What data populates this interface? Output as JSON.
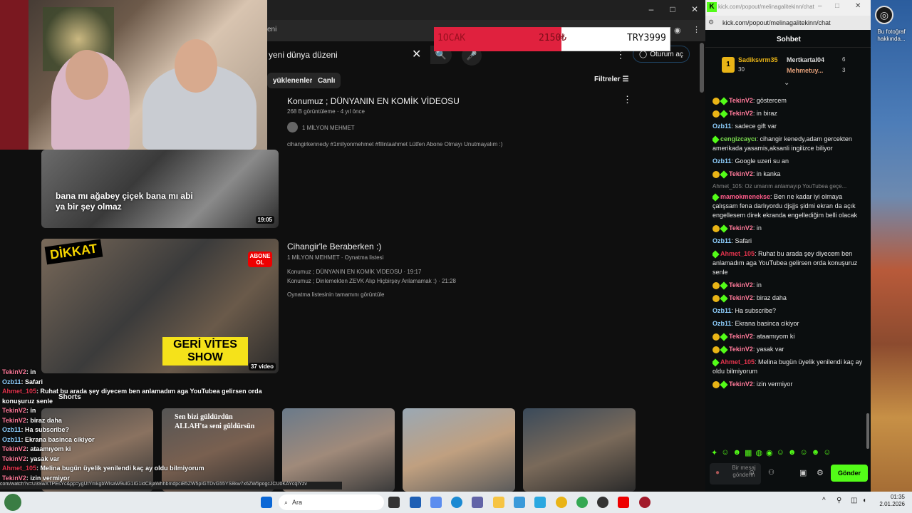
{
  "webcam": {
    "description_icon": "webcam-feed"
  },
  "youtube": {
    "url_fragment": "eni",
    "search_query": "yeni dünya düzeni",
    "signin_label": "Oturum aç",
    "chips": [
      "yüklenenler",
      "Canlı"
    ],
    "filters_label": "Filtreler",
    "videos": [
      {
        "title": "Konumuz ; DÜNYANIN EN KOMİK VİDEOSU",
        "meta": "268 B görüntüleme · 4 yıl önce",
        "channel": "1 MİLYON MEHMET",
        "description": "cihangirkennedy #1milyonmehmet #filintaahmet Lütfen Abone Olmayı Unutmayalım :)",
        "caption": "bana mı ağabey çiçek bana mı abi ya bir şey olmaz",
        "duration": "19:05"
      },
      {
        "title": "Cihangir'le Beraberken :)",
        "channel": "1 MİLYON MEHMET",
        "channel_suffix": "· Oynatma listesi",
        "line1": "Konumuz ; DÜNYANIN EN KOMİK VİDEOSU · 19:17",
        "line2": "Konumuz ; Dinlemekten ZEVK Alıp Hiçbirşey Anlamamak :) · 21:28",
        "line3": "Oynatma listesinin tamamını görüntüle",
        "thumb_text_top": "DİKKAT",
        "thumb_text_bottom": "GERİ VİTES SHOW",
        "thumb_badge": "ABONE OL",
        "count": "37 video"
      }
    ],
    "shorts_label": "Shorts",
    "short_caption": "Sen bizi güldürdün ALLAH'ta seni güldürsün",
    "status_url": "com/watch?v=U3SwXTPEsYc&pp=ygUtYmkgbWlsaW9uIG1lG1ldC8jaWhhbmdpciB5ZW5pIGTDvG55YS8kw7x6ZW5pogcJCU0KAYcqIYzv"
  },
  "overlay": {
    "month": "1OCAK",
    "current": "2150₺",
    "target": "TRY3999",
    "progress": 0.54
  },
  "chat": {
    "url": "kick.com/popout/melinagalitekinn/chat",
    "url_short": "kick.com/popout/melinagalitekinn/chat",
    "header": "Sohbet",
    "top_gifters": [
      {
        "name": "Sadiksvrm35",
        "count": "30"
      },
      {
        "name": "Mertkartal04",
        "count": "6"
      },
      {
        "name": "Mehmetuy...",
        "count": "3"
      }
    ],
    "messages": [
      {
        "user": "TekinV2",
        "text": ": göstercem",
        "cls": "u-yellow",
        "badges": "yg"
      },
      {
        "user": "TekinV2",
        "text": ": in biraz",
        "cls": "u-yellow",
        "badges": "yg"
      },
      {
        "user": "Ozb11",
        "text": ": sadece gift var",
        "cls": "u-blue",
        "badges": ""
      },
      {
        "user": "cengizcaycı",
        "text": ": cihangir kenedy,adam gercekten amerikada yasamis,aksanli ingilizce biliyor",
        "cls": "u-green",
        "badges": "g"
      },
      {
        "user": "Ozb11",
        "text": ": Google uzeri su an",
        "cls": "u-blue",
        "badges": ""
      },
      {
        "user": "TekinV2",
        "text": ": in kanka",
        "cls": "u-yellow",
        "badges": "yg"
      },
      {
        "user": "mamokmenekse",
        "text": ": Ben ne kadar iyi olmaya çalışsam fena darlıyordu djsjjs şidmi ekran da açık engellesem direk ekranda engellediğim belli olacak",
        "cls": "u-orange",
        "badges": "g",
        "reply": "Ahmet_105: Oz umarım anlamayıp YouTubea geçe..."
      },
      {
        "user": "TekinV2",
        "text": ": in",
        "cls": "u-yellow",
        "badges": "yg"
      },
      {
        "user": "Ozb11",
        "text": ": Safari",
        "cls": "u-blue",
        "badges": ""
      },
      {
        "user": "Ahmet_105",
        "text": ": Ruhat bu arada şey diyecem ben anlamadım aga YouTubea gelirsen orda konuşuruz senle",
        "cls": "u-red",
        "badges": "g"
      },
      {
        "user": "TekinV2",
        "text": ": in",
        "cls": "u-yellow",
        "badges": "yg"
      },
      {
        "user": "TekinV2",
        "text": ": biraz daha",
        "cls": "u-yellow",
        "badges": "yg"
      },
      {
        "user": "Ozb11",
        "text": ": Ha subscribe?",
        "cls": "u-blue",
        "badges": ""
      },
      {
        "user": "Ozb11",
        "text": ": Ekrana basinca cikiyor",
        "cls": "u-blue",
        "badges": ""
      },
      {
        "user": "TekinV2",
        "text": ": ataamıyom ki",
        "cls": "u-yellow",
        "badges": "yg"
      },
      {
        "user": "TekinV2",
        "text": ": yasak var",
        "cls": "u-yellow",
        "badges": "yg"
      },
      {
        "user": "Ahmet_105",
        "text": ": Melina bugün üyelik yenilendi kaç ay oldu bilmiyorum",
        "cls": "u-red",
        "badges": "g"
      },
      {
        "user": "TekinV2",
        "text": ": izin vermiyor",
        "cls": "u-yellow",
        "badges": "yg"
      }
    ],
    "input_placeholder": "Bir mesaj gönderin",
    "send_label": "Gönder"
  },
  "ghost_chat": [
    {
      "user": "TekinV2",
      "text": ": in"
    },
    {
      "user": "Ozb11",
      "text": ": Safari"
    },
    {
      "user": "Ahmet_105",
      "text": ": Ruhat bu arada şey diyecem ben anlamadım aga YouTubea gelirsen orda"
    },
    {
      "user": "",
      "text": "konuşuruz senle"
    },
    {
      "user": "TekinV2",
      "text": ": in"
    },
    {
      "user": "TekinV2",
      "text": ": biraz daha"
    },
    {
      "user": "Ozb11",
      "text": ": Ha subscribe?"
    },
    {
      "user": "Ozb11",
      "text": ": Ekrana basinca cikiyor"
    },
    {
      "user": "TekinV2",
      "text": ": ataamıyom ki"
    },
    {
      "user": "TekinV2",
      "text": ": yasak var"
    },
    {
      "user": "Ahmet_105",
      "text": ": Melina bugün üyelik yenilendi kaç ay oldu bilmiyorum"
    },
    {
      "user": "TekinV2",
      "text": ": izin vermiyor"
    }
  ],
  "desktop": {
    "icon_label": "Bu fotoğraf hakkında..."
  },
  "taskbar": {
    "search_label": "Ara",
    "time": "01:35",
    "date": "2.01.2026"
  }
}
